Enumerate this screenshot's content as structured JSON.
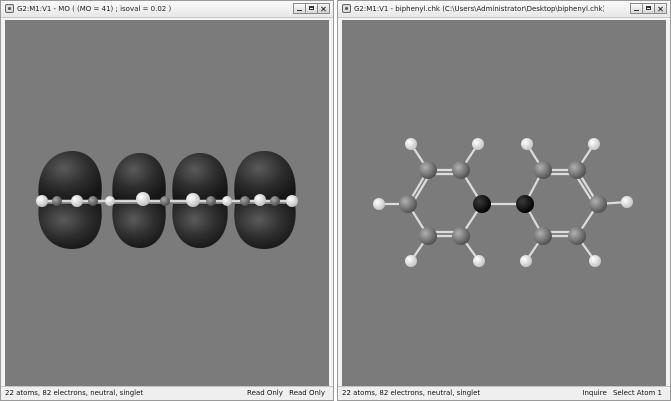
{
  "left_window": {
    "title": "G2:M1:V1 - MO ( (MO = 41) ; isoval = 0.02 )",
    "status": "22 atoms, 82 electrons, neutral, singlet",
    "status_right_1": "Read Only",
    "status_right_2": "Read Only"
  },
  "right_window": {
    "title": "G2:M1:V1 - biphenyl.chk (C:\\Users\\Administrator\\Desktop\\biphenyl.chk)",
    "status": "22 atoms, 82 electrons, neutral, singlet",
    "status_right_1": "Inquire",
    "status_right_2": "Select Atom 1"
  },
  "colors": {
    "viewport_background": "#7b7b7b",
    "orbital_lobe": "#2b2b2b",
    "carbon": "#707070",
    "hydrogen": "#f2f2f2",
    "highlighted_atom": "#050505"
  },
  "icons": [
    "app-icon",
    "minimize-icon",
    "maximize-icon",
    "close-icon"
  ]
}
